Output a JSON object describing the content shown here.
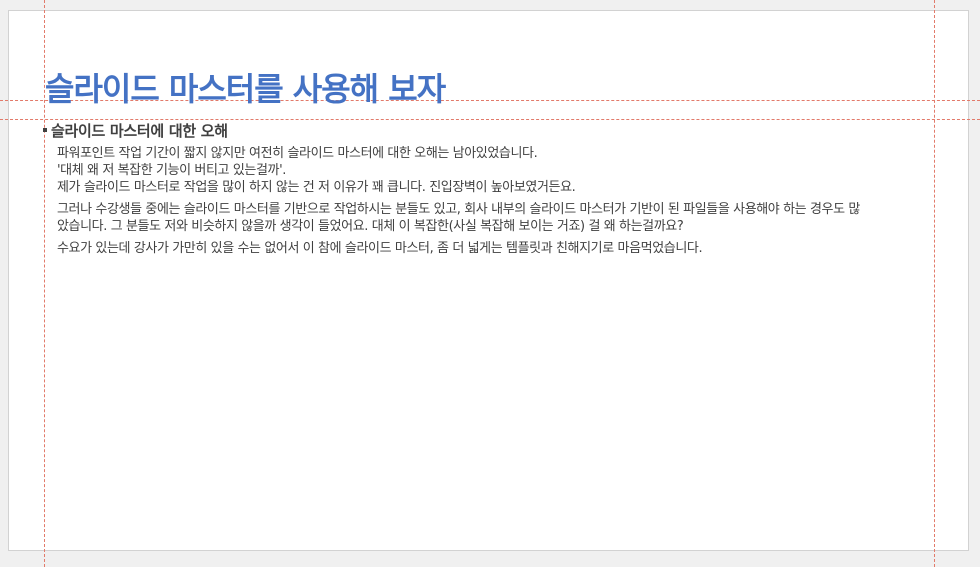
{
  "slide": {
    "title": "슬라이드 마스터를 사용해 보자",
    "subheading": "슬라이드 마스터에 대한 오해",
    "paragraphs": [
      {
        "lines": [
          "파워포인트 작업 기간이 짧지 않지만 여전히 슬라이드 마스터에 대한 오해는 남아있었습니다.",
          "'대체 왜 저 복잡한 기능이 버티고 있는걸까'.",
          "제가 슬라이드 마스터로 작업을 많이 하지 않는 건 저 이유가 꽤 큽니다. 진입장벽이 높아보였거든요."
        ]
      },
      {
        "lines": [
          "그러나 수강생들 중에는 슬라이드 마스터를 기반으로 작업하시는 분들도 있고, 회사 내부의 슬라이드 마스터가 기반이 된 파일들을 사용해야 하는 경우도 많",
          "았습니다. 그 분들도 저와 비슷하지 않을까 생각이 들었어요. 대체 이 복잡한(사실 복잡해 보이는 거죠) 걸 왜 하는걸까요?"
        ]
      },
      {
        "lines": [
          "수요가 있는데 강사가 가만히 있을 수는 없어서 이 참에 슬라이드 마스터, 좀 더 넓게는 템플릿과 친해지기로 마음먹었습니다."
        ]
      }
    ]
  },
  "colors": {
    "title": "#4472c4",
    "text": "#404040",
    "guide": "#e27a6a",
    "canvas": "#f0f0f0"
  }
}
